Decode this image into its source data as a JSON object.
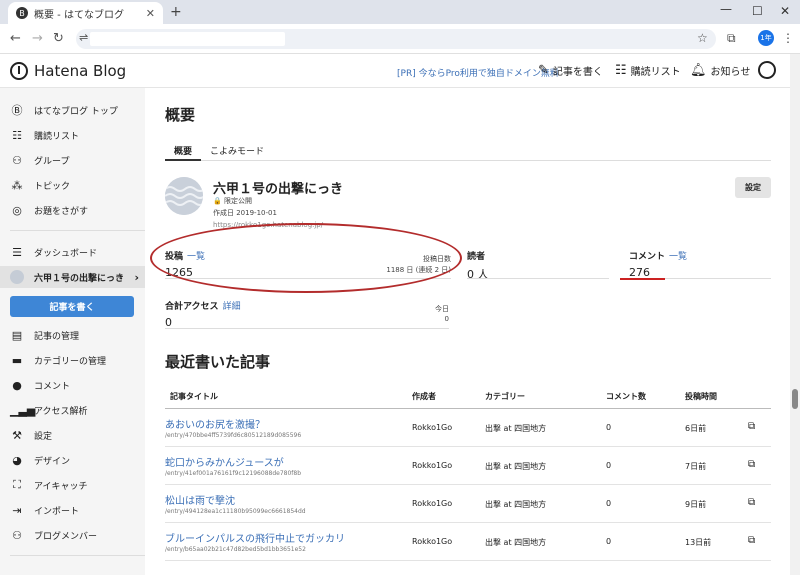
{
  "browser": {
    "tab_title": "概要 - はてなブログ",
    "tab_favicon": "B",
    "close_glyph": "✕",
    "newtab_glyph": "+",
    "profile_label": "1年"
  },
  "header": {
    "logo": "Hatena Blog",
    "promo": "[PR] 今ならPro利用で独自ドメイン無料",
    "write": "記事を書く",
    "subscriptions": "購読リスト",
    "notifications": "お知らせ"
  },
  "sidebar": {
    "items_top": [
      {
        "label": "はてなブログ トップ",
        "icon": "hatena-icon"
      },
      {
        "label": "購読リスト",
        "icon": "reading-list-icon"
      },
      {
        "label": "グループ",
        "icon": "group-icon"
      },
      {
        "label": "トピック",
        "icon": "topic-icon"
      },
      {
        "label": "お題をさがす",
        "icon": "theme-icon"
      }
    ],
    "dashboard": "ダッシュボード",
    "current_blog": "六甲１号の出撃にっき",
    "write_button": "記事を書く",
    "items_manage": [
      {
        "label": "記事の管理",
        "icon": "document-icon"
      },
      {
        "label": "カテゴリーの管理",
        "icon": "folder-icon"
      },
      {
        "label": "コメント",
        "icon": "comment-icon"
      },
      {
        "label": "アクセス解析",
        "icon": "bar-chart-icon"
      },
      {
        "label": "設定",
        "icon": "wrench-icon"
      },
      {
        "label": "デザイン",
        "icon": "palette-icon"
      },
      {
        "label": "アイキャッチ",
        "icon": "eyecatch-icon"
      },
      {
        "label": "インポート",
        "icon": "import-icon"
      },
      {
        "label": "ブログメンバー",
        "icon": "members-icon"
      }
    ]
  },
  "main": {
    "title": "概要",
    "tabs": [
      "概要",
      "こよみモード"
    ],
    "blog": {
      "name": "六甲１号の出撃にっき",
      "visibility": "🔒 限定公開",
      "created": "作成日 2019-10-01",
      "url": "https://rokko1go.hatenablog.jp/"
    },
    "settings_button": "設定",
    "stats": {
      "posts": {
        "label": "投稿",
        "link": "一覧",
        "value": "1265",
        "days_label": "投稿日数",
        "days": "1188 日 (連続 2 日)"
      },
      "readers": {
        "label": "読者",
        "value": "0 人"
      },
      "comments": {
        "label": "コメント",
        "link": "一覧",
        "value": "276"
      },
      "access": {
        "label": "合計アクセス",
        "link": "詳細",
        "value": "0",
        "today_label": "今日",
        "today": "0"
      }
    },
    "recent_title": "最近書いた記事",
    "table_headers": [
      "記事タイトル",
      "作成者",
      "カテゴリー",
      "コメント数",
      "投稿時間"
    ],
    "rows": [
      {
        "title": "あおいのお尻を激撮？",
        "path": "/entry/470bbe4ff5739fd6c80512189d085596",
        "author": "Rokko1Go",
        "category": "出撃 at 四国地方",
        "comments": "0",
        "time": "6日前"
      },
      {
        "title": "蛇口からみかんジュースが",
        "path": "/entry/41ef001a76161f9c12196088de780f8b",
        "author": "Rokko1Go",
        "category": "出撃 at 四国地方",
        "comments": "0",
        "time": "7日前"
      },
      {
        "title": "松山は雨で撃沈",
        "path": "/entry/494128ea1c11180b95099ec6661854dd",
        "author": "Rokko1Go",
        "category": "出撃 at 四国地方",
        "comments": "0",
        "time": "9日前"
      },
      {
        "title": "ブルーインパルスの飛行中止でガッカリ",
        "path": "/entry/b65aa02b21c47d82bed5bd1bb3651e52",
        "author": "Rokko1Go",
        "category": "出撃 at 四国地方",
        "comments": "0",
        "time": "13日前"
      }
    ]
  }
}
